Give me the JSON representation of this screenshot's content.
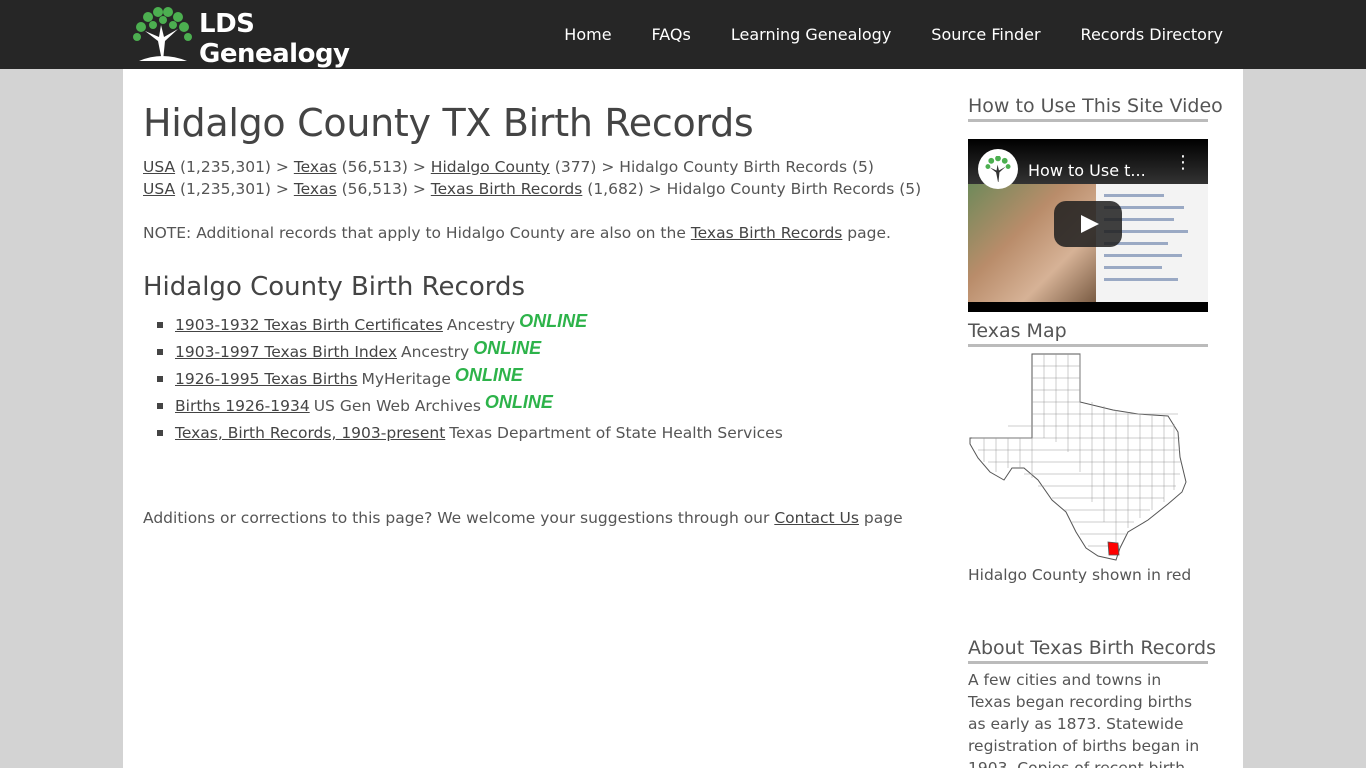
{
  "site": {
    "logo_text": "LDS Genealogy",
    "nav": [
      "Home",
      "FAQs",
      "Learning Genealogy",
      "Source Finder",
      "Records Directory"
    ]
  },
  "page": {
    "title": "Hidalgo County TX Birth Records",
    "breadcrumb1": [
      {
        "text": "USA",
        "link": true
      },
      {
        "text": " (1,235,301) > ",
        "link": false
      },
      {
        "text": "Texas",
        "link": true
      },
      {
        "text": " (56,513) > ",
        "link": false
      },
      {
        "text": "Hidalgo County",
        "link": true
      },
      {
        "text": " (377) > Hidalgo County Birth Records (5)",
        "link": false
      }
    ],
    "breadcrumb2": [
      {
        "text": "USA",
        "link": true
      },
      {
        "text": " (1,235,301) > ",
        "link": false
      },
      {
        "text": "Texas",
        "link": true
      },
      {
        "text": " (56,513) > ",
        "link": false
      },
      {
        "text": "Texas Birth Records",
        "link": true
      },
      {
        "text": " (1,682) > Hidalgo County Birth Records (5)",
        "link": false
      }
    ],
    "note_prefix": "NOTE: Additional records that apply to Hidalgo County are also on the ",
    "note_link": "Texas Birth Records",
    "note_suffix": " page.",
    "section_title": "Hidalgo County Birth Records",
    "records": [
      {
        "title": "1903-1932 Texas Birth Certificates",
        "source": "Ancestry",
        "online": "ONLINE"
      },
      {
        "title": "1903-1997 Texas Birth Index",
        "source": "Ancestry",
        "online": "ONLINE"
      },
      {
        "title": "1926-1995 Texas Births",
        "source": "MyHeritage",
        "online": "ONLINE"
      },
      {
        "title": "Births 1926-1934",
        "source": "US Gen Web Archives",
        "online": "ONLINE"
      },
      {
        "title": "Texas, Birth Records, 1903-present",
        "source": "Texas Department of State Health Services",
        "online": ""
      }
    ],
    "footer_prefix": "Additions or corrections to this page? We welcome your suggestions through our ",
    "footer_link": "Contact Us",
    "footer_suffix": " page"
  },
  "sidebar": {
    "video_heading": "How to Use This Site Video",
    "video_title": "How to Use t...",
    "map_heading": "Texas Map",
    "map_caption": "Hidalgo County shown in red",
    "about_heading": "About Texas Birth Records",
    "about_text": "A few cities and towns in Texas began recording births as early as 1873. Statewide registration of births began in 1903. Copies of recent birth certificates can"
  },
  "colors": {
    "header_bg": "#262626",
    "online_green": "#2db34a",
    "highlight_red": "#ff0000"
  }
}
